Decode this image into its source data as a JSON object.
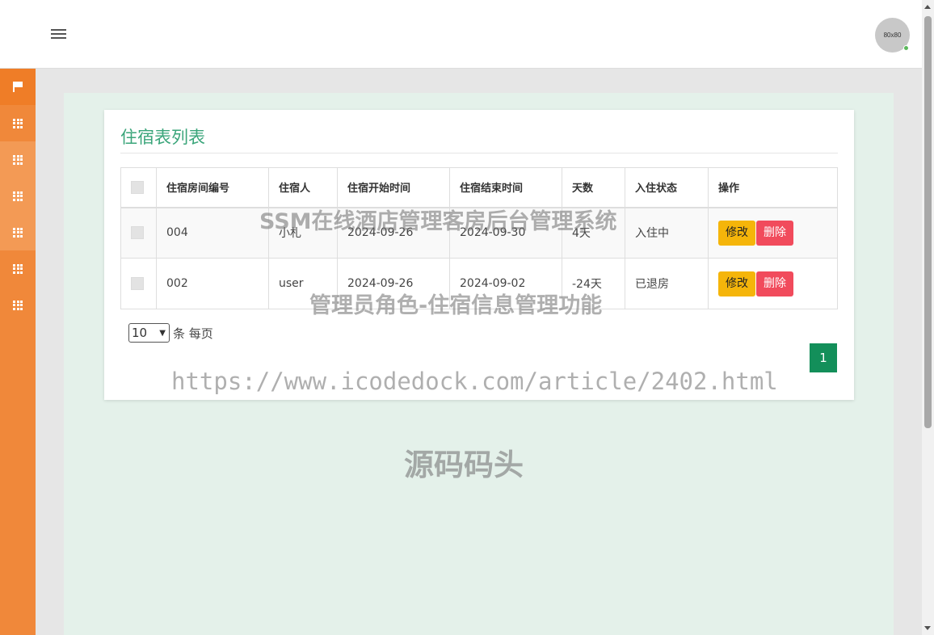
{
  "header": {
    "avatar_text": "80x80"
  },
  "sidebar": {
    "items": [
      {
        "icon": "flag-icon"
      },
      {
        "icon": "grid-icon"
      },
      {
        "icon": "grid-icon"
      },
      {
        "icon": "grid-icon"
      },
      {
        "icon": "grid-icon"
      },
      {
        "icon": "grid-icon"
      },
      {
        "icon": "grid-icon"
      }
    ]
  },
  "panel": {
    "title": "住宿表列表"
  },
  "table": {
    "headers": [
      "住宿房间编号",
      "住宿人",
      "住宿开始时间",
      "住宿结束时间",
      "天数",
      "入住状态",
      "操作"
    ],
    "rows": [
      {
        "room": "004",
        "guest": "小札",
        "start": "2024-09-26",
        "end": "2024-09-30",
        "days": "4天",
        "status": "入住中"
      },
      {
        "room": "002",
        "guest": "user",
        "start": "2024-09-26",
        "end": "2024-09-02",
        "days": "-24天",
        "status": "已退房"
      }
    ],
    "edit_label": "修改",
    "delete_label": "删除"
  },
  "pager": {
    "page_size": "10",
    "page_size_label": "条 每页",
    "current_page": "1"
  },
  "watermark": {
    "line1": "SSM在线酒店管理客房后台管理系统",
    "line2": "管理员角色-住宿信息管理功能",
    "line3": "https://www.icodedock.com/article/2402.html",
    "line4": "源码码头"
  },
  "colors": {
    "sidebar": "#f0883a",
    "accent": "#3aa57a",
    "edit": "#f5b50a",
    "delete": "#f14b5c",
    "page_active": "#138f5a"
  }
}
